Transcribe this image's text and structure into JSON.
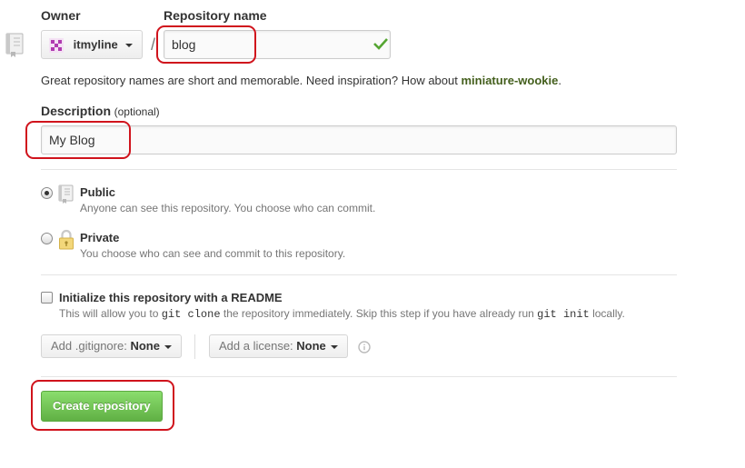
{
  "owner": {
    "label": "Owner",
    "selected": "itmyline",
    "avatar_color": "#b03bb0"
  },
  "repo_name": {
    "label": "Repository name",
    "separator": "/",
    "value": "blog",
    "valid_color": "#55a532"
  },
  "suggestion": {
    "text": "Great repository names are short and memorable. Need inspiration? How about ",
    "name": "miniature-wookie",
    "end": ".",
    "name_color": "#445f1d"
  },
  "description": {
    "label": "Description",
    "optional": "(optional)",
    "value": "My Blog"
  },
  "visibility": {
    "public": {
      "label": "Public",
      "hint": "Anyone can see this repository. You choose who can commit.",
      "icon": "repo-icon",
      "selected": true
    },
    "private": {
      "label": "Private",
      "hint": "You choose who can see and commit to this repository.",
      "icon": "lock-icon",
      "selected": false
    }
  },
  "readme": {
    "label": "Initialize this repository with a README",
    "hint_pre": "This will allow you to ",
    "hint_code1": "git clone",
    "hint_mid": " the repository immediately. Skip this step if you have already run ",
    "hint_code2": "git init",
    "hint_post": " locally.",
    "checked": false
  },
  "gitignore": {
    "prefix": "Add .gitignore: ",
    "value": "None"
  },
  "license": {
    "prefix": "Add a license: ",
    "value": "None",
    "info_icon": "info-icon"
  },
  "submit": {
    "label": "Create repository",
    "color": "#60b044"
  },
  "annotation_color": "#d0131c"
}
